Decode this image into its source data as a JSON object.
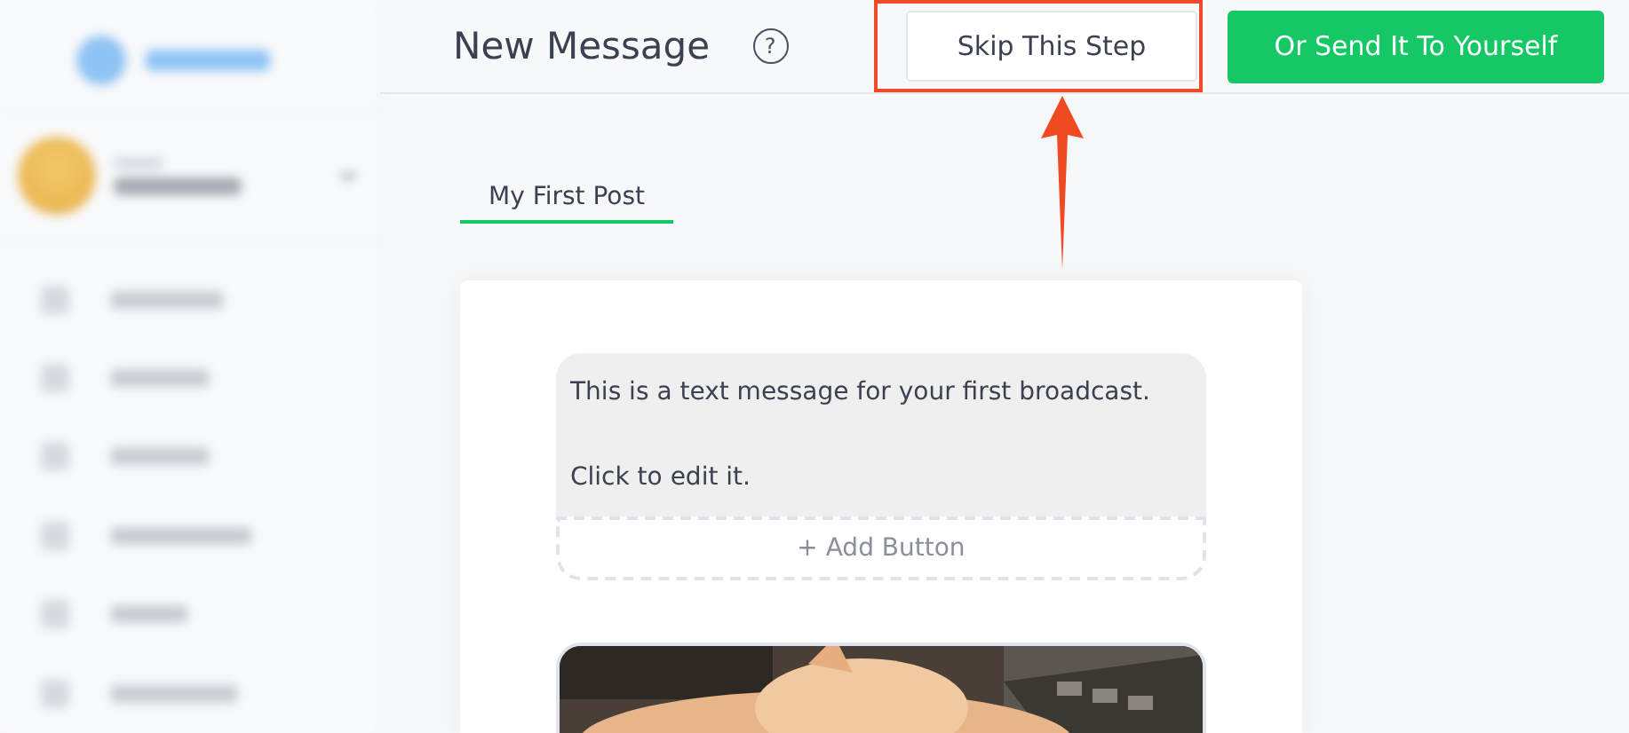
{
  "sidebar": {
    "blurred": true
  },
  "header": {
    "title": "New Message",
    "help": "?",
    "skip_button": {
      "label": "Skip This Step",
      "highlighted": true
    },
    "send_button": {
      "label": "Or Send It To Yourself"
    }
  },
  "tabs": [
    {
      "label": "My First Post",
      "selected": true
    }
  ],
  "message": {
    "lines": [
      "This is a text message for your first broadcast.",
      "Click to edit it."
    ],
    "add_button": "+ Add Button"
  }
}
